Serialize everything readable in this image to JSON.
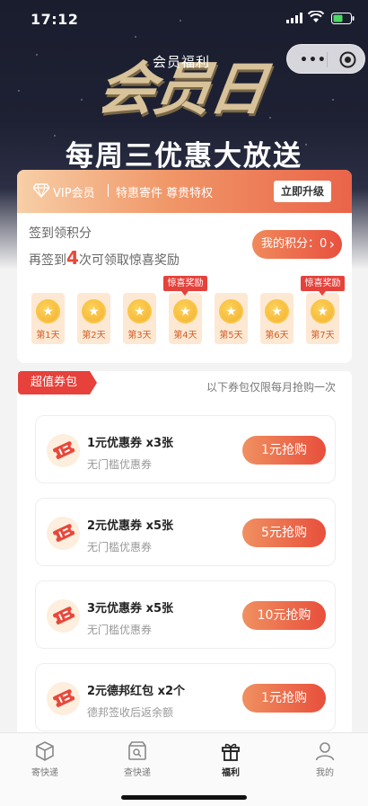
{
  "status": {
    "time": "17:12"
  },
  "hero": {
    "logo_big": "会员日",
    "logo_small": "会员福利",
    "slogan": "每周三优惠大放送"
  },
  "vip": {
    "label": "VIP会员",
    "perks": "特惠寄件  尊贵特权",
    "upgrade_label": "立即升级"
  },
  "signin": {
    "title": "签到领积分",
    "desc_prefix": "再签到",
    "desc_num": "4",
    "desc_suffix": "次可领取惊喜奖励",
    "points_label": "我的积分：0",
    "days": [
      {
        "label": "第1天",
        "tag": ""
      },
      {
        "label": "第2天",
        "tag": ""
      },
      {
        "label": "第3天",
        "tag": ""
      },
      {
        "label": "第4天",
        "tag": "惊喜奖励"
      },
      {
        "label": "第5天",
        "tag": ""
      },
      {
        "label": "第6天",
        "tag": ""
      },
      {
        "label": "第7天",
        "tag": "惊喜奖励"
      }
    ]
  },
  "coupons": {
    "section_title": "超值券包",
    "section_note": "以下券包仅限每月抢购一次",
    "items": [
      {
        "title": "1元优惠券 x3张",
        "subtitle": "无门槛优惠券",
        "button": "1元抢购"
      },
      {
        "title": "2元优惠券 x5张",
        "subtitle": "无门槛优惠券",
        "button": "5元抢购"
      },
      {
        "title": "3元优惠券 x5张",
        "subtitle": "无门槛优惠券",
        "button": "10元抢购"
      },
      {
        "title": "2元德邦红包 x2个",
        "subtitle": "德邦签收后返余额",
        "button": "1元抢购"
      }
    ]
  },
  "tabbar": {
    "tabs": [
      {
        "label": "寄快递",
        "icon": "package-icon"
      },
      {
        "label": "查快递",
        "icon": "track-icon"
      },
      {
        "label": "福利",
        "icon": "gift-icon"
      },
      {
        "label": "我的",
        "icon": "user-icon"
      }
    ],
    "active": "福利"
  },
  "colors": {
    "accent": "#e8483a",
    "gold": "#d8c29a",
    "header_bg": "#1a1d2e"
  }
}
